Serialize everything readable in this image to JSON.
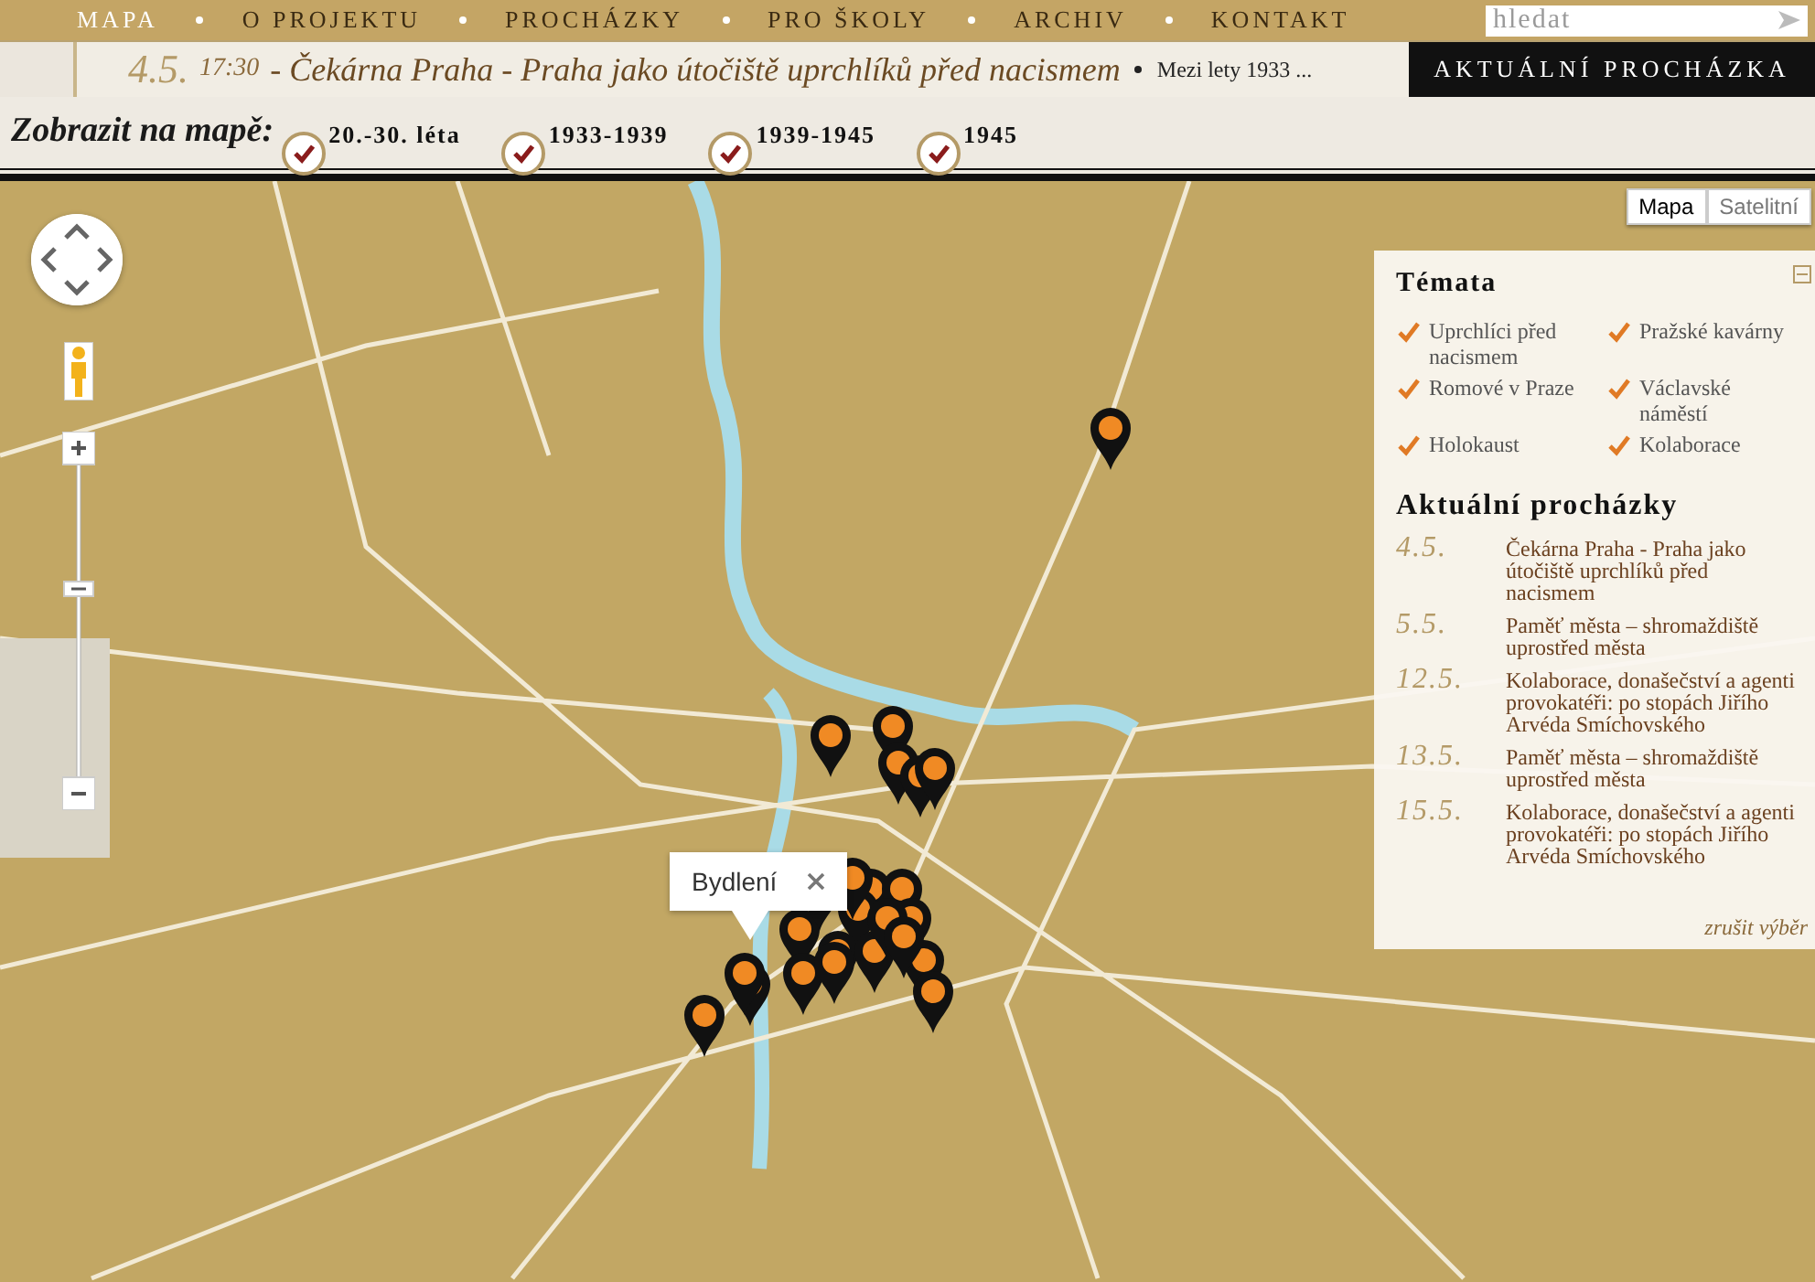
{
  "nav": {
    "items": [
      {
        "label": "MAPA",
        "selected": true
      },
      {
        "label": "O PROJEKTU",
        "selected": false
      },
      {
        "label": "PROCHÁZKY",
        "selected": false
      },
      {
        "label": "PRO ŠKOLY",
        "selected": false
      },
      {
        "label": "ARCHIV",
        "selected": false
      },
      {
        "label": "KONTAKT",
        "selected": false
      }
    ],
    "search": {
      "placeholder": "hledat"
    }
  },
  "ticker": {
    "date": "4.5.",
    "time": "17:30",
    "title": "- Čekárna Praha - Praha jako útočiště uprchlíků před nacismem",
    "excerpt": "Mezi lety 1933 ...",
    "button": "AKTUÁLNÍ PROCHÁZKA"
  },
  "filter": {
    "label": "Zobrazit na mapě:",
    "periods": [
      {
        "label": "20.-30. léta",
        "checked": true
      },
      {
        "label": "1933-1939",
        "checked": true
      },
      {
        "label": "1939-1945",
        "checked": true
      },
      {
        "label": "1945",
        "checked": true
      }
    ]
  },
  "map": {
    "type_buttons": [
      {
        "label": "Mapa",
        "selected": true
      },
      {
        "label": "Satelitní",
        "selected": false
      }
    ],
    "popup": "Bydlení"
  },
  "panel": {
    "themes_title": "Témata",
    "themes": [
      {
        "label": "Uprchlíci před nacismem",
        "checked": true
      },
      {
        "label": "Pražské kavárny",
        "checked": true
      },
      {
        "label": "Romové v Praze",
        "checked": true
      },
      {
        "label": "Václavské náměstí",
        "checked": true
      },
      {
        "label": "Holokaust",
        "checked": true
      },
      {
        "label": "Kolaborace",
        "checked": true
      }
    ],
    "walks_title": "Aktuální procházky",
    "walks": [
      {
        "date": "4.5.",
        "title": "Čekárna Praha - Praha jako útočiště uprchlíků před nacismem"
      },
      {
        "date": "5.5.",
        "title": "Paměť města – shromaždiště uprostřed města"
      },
      {
        "date": "12.5.",
        "title": "Kolaborace, donašečství a agenti provokatéři: po stopách Jiřího Arvéda Smíchovského"
      },
      {
        "date": "13.5.",
        "title": "Paměť města – shromaždiště uprostřed města"
      },
      {
        "date": "15.5.",
        "title": "Kolaborace, donašečství a agenti provokatéři: po stopách Jiřího Arvéda Smíchovského"
      }
    ],
    "clear": "zrušit výběr"
  }
}
